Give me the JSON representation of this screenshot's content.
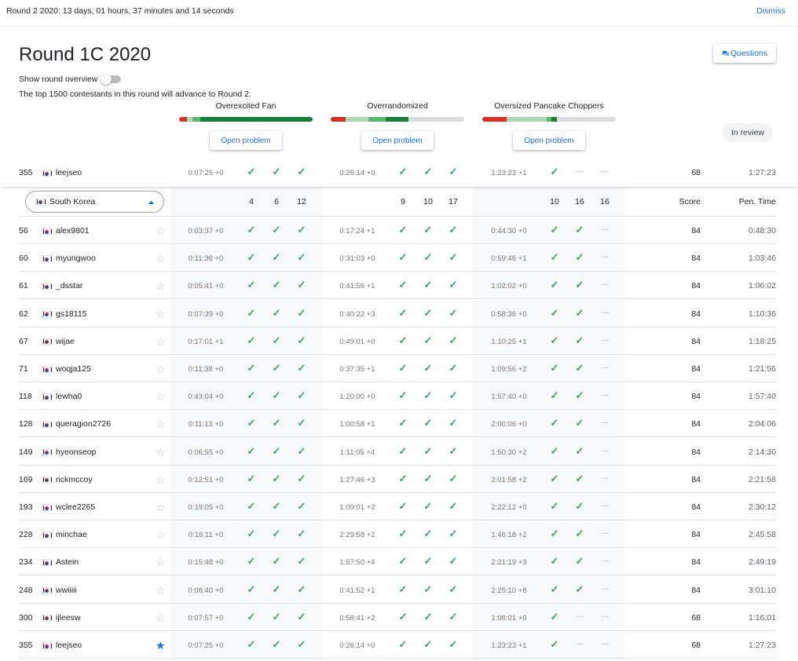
{
  "banner": {
    "text": "Round 2 2020:  13 days, 01 hours, 37 minutes and 14 seconds",
    "dismiss": "Dismiss"
  },
  "round": {
    "title": "Round 1C 2020",
    "overview_label": "Show round overview",
    "advance_text": "The top 1500 contestants in this round will advance to Round 2.",
    "questions_label": "Questions",
    "review_status": "In review"
  },
  "colors": {
    "red": "#d93025",
    "light_green": "#a8dab5",
    "mid_green": "#57bb6a",
    "dark_green": "#188038",
    "grey": "#dadce0",
    "accent": "#1a73e8"
  },
  "problems": [
    {
      "name": "Overexcited Fan",
      "open_label": "Open problem",
      "counts": [
        "4",
        "6",
        "12"
      ]
    },
    {
      "name": "Overrandomized",
      "open_label": "Open problem",
      "counts": [
        "9",
        "10",
        "17"
      ]
    },
    {
      "name": "Oversized Pancake Choppers",
      "open_label": "Open problem",
      "counts": [
        "10",
        "16",
        "16"
      ]
    }
  ],
  "filter": {
    "country": "South Korea"
  },
  "columns": {
    "score": "Score",
    "pen_time": "Pen. Time"
  },
  "my_row": {
    "rank": "355",
    "name": "leejseo",
    "t": [
      "0:07:25 +0",
      "0:26:14 +0",
      "1:23:23 +1"
    ],
    "r": [
      "vvv",
      "vvv",
      "v--"
    ],
    "score": "68",
    "pen": "1:27:23"
  },
  "rows": [
    {
      "rank": "56",
      "name": "alex9801",
      "t": [
        "0:03:37 +0",
        "0:17:24 +1",
        "0:44:30 +0"
      ],
      "r": [
        "vvv",
        "vvv",
        "vv-"
      ],
      "score": "84",
      "pen": "0:48:30",
      "starred": false
    },
    {
      "rank": "60",
      "name": "myungwoo",
      "t": [
        "0:11:36 +0",
        "0:31:03 +0",
        "0:59:46 +1"
      ],
      "r": [
        "vvv",
        "vvv",
        "vv-"
      ],
      "score": "84",
      "pen": "1:03:46",
      "starred": false
    },
    {
      "rank": "61",
      "name": "_dsstar",
      "t": [
        "0:05:41 +0",
        "0:41:56 +1",
        "1:02:02 +0"
      ],
      "r": [
        "vvv",
        "vvv",
        "vv-"
      ],
      "score": "84",
      "pen": "1:06:02",
      "starred": false
    },
    {
      "rank": "62",
      "name": "gs18115",
      "t": [
        "0:07:39 +0",
        "0:40:22 +3",
        "0:58:36 +0"
      ],
      "r": [
        "vvv",
        "vvv",
        "vv-"
      ],
      "score": "84",
      "pen": "1:10:36",
      "starred": false
    },
    {
      "rank": "67",
      "name": "wijae",
      "t": [
        "0:17:01 +1",
        "0:49:01 +0",
        "1:10:25 +1"
      ],
      "r": [
        "vvv",
        "vvv",
        "vv-"
      ],
      "score": "84",
      "pen": "1:18:25",
      "starred": false
    },
    {
      "rank": "71",
      "name": "woqja125",
      "t": [
        "0:11:38 +0",
        "0:37:35 +1",
        "1:09:56 +2"
      ],
      "r": [
        "vvv",
        "vvv",
        "vv-"
      ],
      "score": "84",
      "pen": "1:21:56",
      "starred": false
    },
    {
      "rank": "118",
      "name": "lewha0",
      "t": [
        "0:43:04 +0",
        "1:20:00 +0",
        "1:57:40 +0"
      ],
      "r": [
        "vvv",
        "vvv",
        "vv-"
      ],
      "score": "84",
      "pen": "1:57:40",
      "starred": false
    },
    {
      "rank": "128",
      "name": "queragion2726",
      "t": [
        "0:11:13 +0",
        "1:00:58 +1",
        "2:00:06 +0"
      ],
      "r": [
        "vvv",
        "vvv",
        "vv-"
      ],
      "score": "84",
      "pen": "2:04:06",
      "starred": false
    },
    {
      "rank": "149",
      "name": "hyeonseop",
      "t": [
        "0:06:55 +0",
        "1:11:05 +4",
        "1:50:30 +2"
      ],
      "r": [
        "vvv",
        "vvv",
        "vv-"
      ],
      "score": "84",
      "pen": "2:14:30",
      "starred": false
    },
    {
      "rank": "169",
      "name": "rickmccoy",
      "t": [
        "0:12:51 +0",
        "1:27:46 +3",
        "2:01:58 +2"
      ],
      "r": [
        "vvv",
        "vvv",
        "vv-"
      ],
      "score": "84",
      "pen": "2:21:58",
      "starred": false
    },
    {
      "rank": "193",
      "name": "wclee2265",
      "t": [
        "0:19:05 +0",
        "1:09:01 +2",
        "2:22:12 +0"
      ],
      "r": [
        "vvv",
        "vvv",
        "vv-"
      ],
      "score": "84",
      "pen": "2:30:12",
      "starred": false
    },
    {
      "rank": "228",
      "name": "minchae",
      "t": [
        "0:16:11 +0",
        "2:29:58 +2",
        "1:46:18 +2"
      ],
      "r": [
        "vvv",
        "vvv",
        "vv-"
      ],
      "score": "84",
      "pen": "2:45:58",
      "starred": false
    },
    {
      "rank": "234",
      "name": "Astein",
      "t": [
        "0:15:48 +0",
        "1:57:50 +4",
        "2:21:19 +3"
      ],
      "r": [
        "vvv",
        "vvv",
        "vv-"
      ],
      "score": "84",
      "pen": "2:49:19",
      "starred": false
    },
    {
      "rank": "248",
      "name": "wwiiiii",
      "t": [
        "0:08:40 +0",
        "0:41:52 +1",
        "2:25:10 +8"
      ],
      "r": [
        "vvv",
        "vvv",
        "vv-"
      ],
      "score": "84",
      "pen": "3:01:10",
      "starred": false
    },
    {
      "rank": "300",
      "name": "ijleesw",
      "t": [
        "0:07:57 +0",
        "0:58:41 +2",
        "1:08:01 +0"
      ],
      "r": [
        "vvv",
        "vvv",
        "v--"
      ],
      "score": "68",
      "pen": "1:16:01",
      "starred": false
    },
    {
      "rank": "355",
      "name": "leejseo",
      "t": [
        "0:07:25 +0",
        "0:26:14 +0",
        "1:23:23 +1"
      ],
      "r": [
        "vvv",
        "vvv",
        "v--"
      ],
      "score": "68",
      "pen": "1:27:23",
      "starred": true
    }
  ]
}
